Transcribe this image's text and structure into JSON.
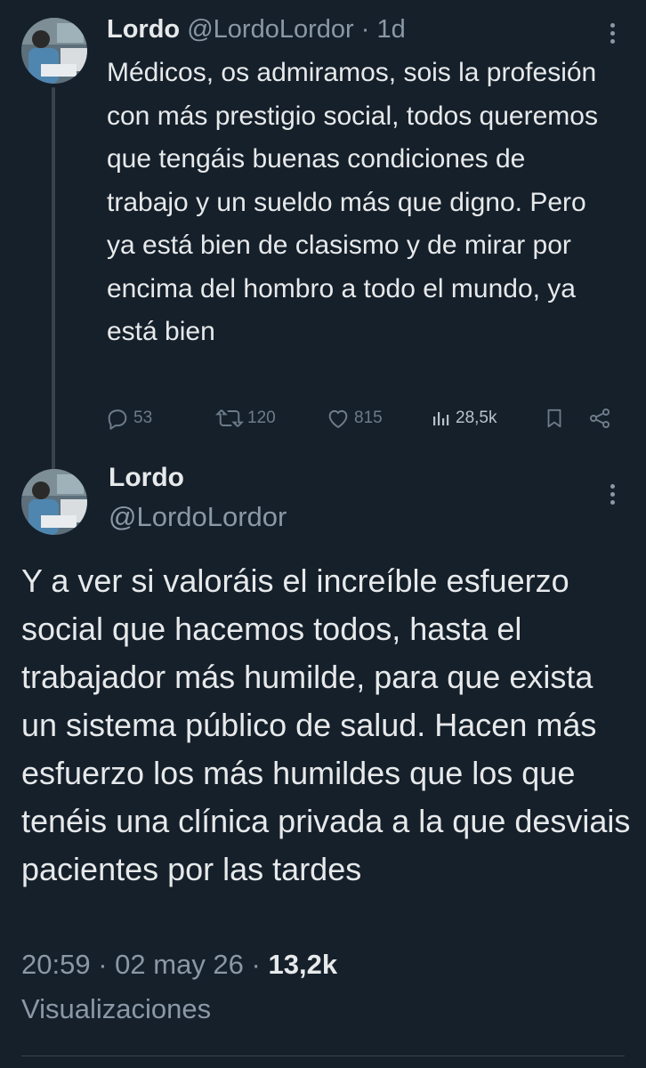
{
  "tweet1": {
    "name": "Lordo",
    "handle": "@LordoLordor",
    "separator": "·",
    "time": "1d",
    "text": "Médicos, os admiramos, sois la profesión con más prestigio social, todos queremos que tengáis buenas condiciones de trabajo y un sueldo más que digno. Pero ya está bien de clasismo y de mirar por encima del hombro a todo el mundo, ya está bien",
    "actions": {
      "replies": "53",
      "retweets": "120",
      "likes": "815",
      "views": "28,5k"
    }
  },
  "tweet2": {
    "name": "Lordo",
    "handle": "@LordoLordor",
    "text": "Y a ver si valoráis el increíble esfuerzo social que hacemos todos, hasta el trabajador más humilde, para que exista un sistema público de salud. Hacen más esfuerzo los más humildes que los que tenéis una clínica privada a la que desviais pacientes por las tardes",
    "time": "20:59",
    "date": "02 may 26",
    "separator": "·",
    "views_count": "13,2k",
    "views_label": "Visualizaciones"
  },
  "icons": {
    "reply": "reply-icon",
    "retweet": "retweet-icon",
    "like": "heart-icon",
    "views": "views-icon",
    "bookmark": "bookmark-icon",
    "share": "share-icon",
    "more": "more-icon"
  },
  "colors": {
    "background": "#15202b",
    "text": "#e7e9ea",
    "muted": "#8b98a5"
  }
}
